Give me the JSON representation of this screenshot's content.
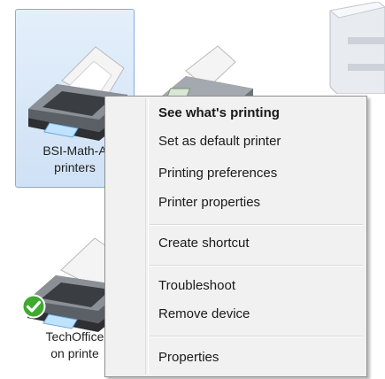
{
  "devices": [
    {
      "label_line1": "BSI-Math-A",
      "label_line2": "printers",
      "selected": true
    },
    {
      "label_line1": "TechOffice",
      "label_line2": "on printe",
      "is_default": true
    }
  ],
  "context_menu": {
    "items": [
      {
        "label": "See what's printing",
        "bold": true
      },
      {
        "label": "Set as default printer"
      },
      {
        "label": "Printing preferences"
      },
      {
        "label": "Printer properties"
      },
      {
        "label": "Create shortcut"
      },
      {
        "label": "Troubleshoot"
      },
      {
        "label": "Remove device"
      },
      {
        "label": "Properties"
      }
    ]
  },
  "colors": {
    "selection_fill": "#cfe1f5",
    "selection_border": "#84acdd",
    "menu_background": "#f1f1f1",
    "default_check": "#3faa2f"
  }
}
